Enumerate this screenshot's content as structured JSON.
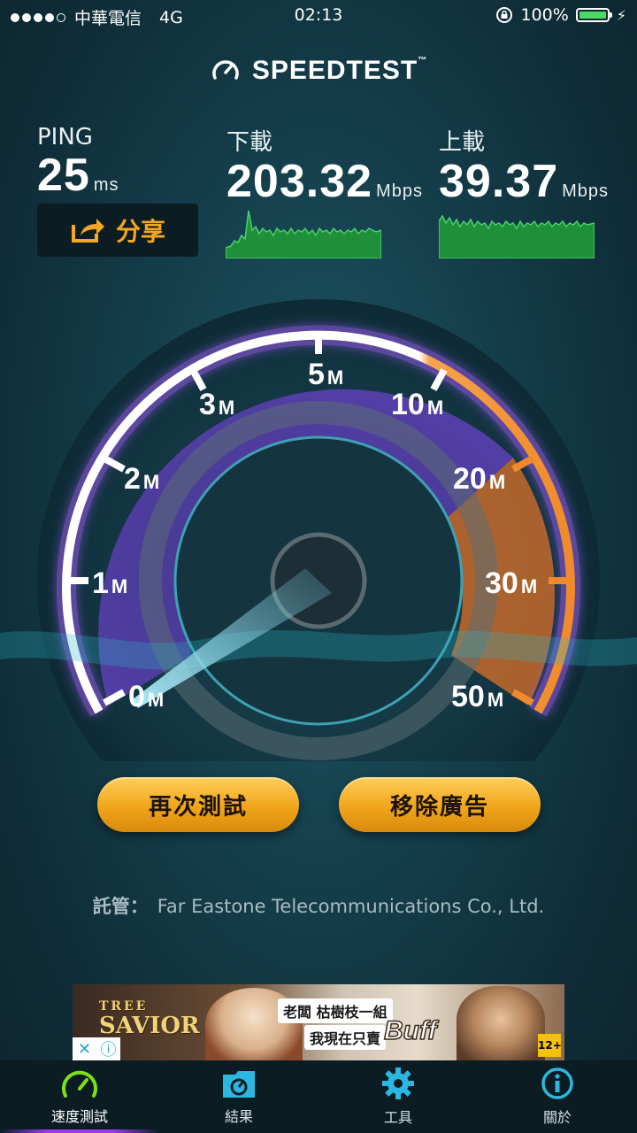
{
  "status_bar": {
    "carrier": "中華電信",
    "network": "4G",
    "time": "02:13",
    "battery": "100%",
    "battery_level": 1.0
  },
  "brand": {
    "name": "SPEEDTEST",
    "tm": "™"
  },
  "metrics": {
    "ping": {
      "label": "PING",
      "value": "25",
      "unit": "ms"
    },
    "download": {
      "label": "下載",
      "value": "203.32",
      "unit": "Mbps"
    },
    "upload": {
      "label": "上載",
      "value": "39.37",
      "unit": "Mbps"
    }
  },
  "share": {
    "label": "分享"
  },
  "gauge": {
    "ticks": [
      {
        "num": "0",
        "unit": "M"
      },
      {
        "num": "1",
        "unit": "M"
      },
      {
        "num": "2",
        "unit": "M"
      },
      {
        "num": "3",
        "unit": "M"
      },
      {
        "num": "5",
        "unit": "M"
      },
      {
        "num": "10",
        "unit": "M"
      },
      {
        "num": "20",
        "unit": "M"
      },
      {
        "num": "30",
        "unit": "M"
      },
      {
        "num": "50",
        "unit": "M"
      }
    ],
    "colors": {
      "purple": "#9b5cf0",
      "orange": "#f08a2a"
    }
  },
  "buttons": {
    "retest": "再次測試",
    "remove_ads": "移除廣告"
  },
  "host": {
    "label": "託管：",
    "name": "Far Eastone Telecommunications Co., Ltd."
  },
  "ad": {
    "logo_line1": "TREE",
    "logo_line2": "SAVIOR",
    "line1": "老闆 枯樹枝一組",
    "line2": "我現在只賣",
    "buff": "Buff",
    "rating": "12+"
  },
  "tabs": [
    {
      "label": "速度測試",
      "icon": "speedometer-icon",
      "active": true
    },
    {
      "label": "結果",
      "icon": "results-folder-icon",
      "active": false
    },
    {
      "label": "工具",
      "icon": "gear-icon",
      "active": false
    },
    {
      "label": "關於",
      "icon": "info-icon",
      "active": false
    }
  ]
}
